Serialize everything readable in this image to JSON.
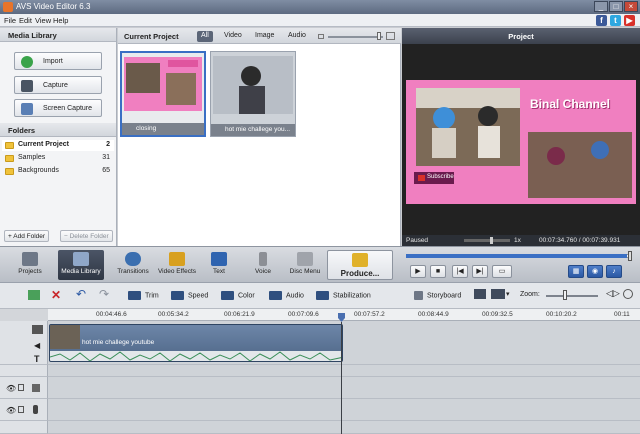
{
  "window": {
    "title": "AVS Video Editor 6.3",
    "controls": [
      "_",
      "□",
      "×"
    ]
  },
  "menu": {
    "items": [
      "File",
      "Edit",
      "View",
      "Help"
    ],
    "social": [
      "f",
      "t",
      "▶"
    ]
  },
  "media_library": {
    "title": "Media Library",
    "buttons": [
      "Import",
      "Capture",
      "Screen Capture"
    ],
    "folders_title": "Folders",
    "folders": [
      {
        "name": "Current Project",
        "count": "2"
      },
      {
        "name": "Samples",
        "count": "31"
      },
      {
        "name": "Backgrounds",
        "count": "65"
      }
    ],
    "add_folder": "+ Add Folder",
    "delete_folder": "− Delete Folder"
  },
  "current_project": {
    "title": "Current Project",
    "filters": [
      "All",
      "Video",
      "Image",
      "Audio"
    ],
    "active_filter": "All",
    "clips": [
      {
        "name": "closing"
      },
      {
        "name": "hot mie challege you..."
      }
    ]
  },
  "preview": {
    "title": "Project",
    "channel_name": "Binal Channel",
    "subscribe_label": "Subscribe",
    "state": "Paused",
    "speed": "1x",
    "time": "00:07:34.760 / 00:07:39.931",
    "progress": 0.98
  },
  "toolbar": {
    "buttons": [
      "Projects",
      "Media Library",
      "Transitions",
      "Video Effects",
      "Text",
      "Voice",
      "Disc Menu",
      "Produce..."
    ],
    "active": "Media Library"
  },
  "timeline_toolbar": {
    "tools": [
      "Trim",
      "Speed",
      "Color",
      "Audio",
      "Stabilization"
    ],
    "storyboard": "Storyboard",
    "zoom_label": "Zoom:"
  },
  "timeline": {
    "ticks": [
      "00:04:46.6",
      "00:05:34.2",
      "00:06:21.9",
      "00:07:09.6",
      "00:07:57.2",
      "00:08:44.9",
      "00:09:32.5",
      "00:10:20.2",
      "00:11"
    ],
    "clip_label": "hot mie challege youtube"
  },
  "colors": {
    "accent": "#3a6fc4",
    "pink_bg": "#f07fc0",
    "toolbar_active": "#2f3744"
  }
}
